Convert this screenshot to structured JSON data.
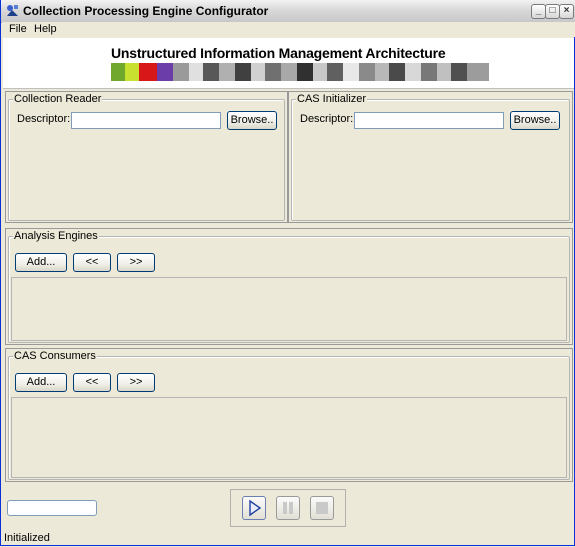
{
  "window": {
    "title": "Collection Processing Engine Configurator"
  },
  "menu": {
    "items": [
      "File",
      "Help"
    ]
  },
  "banner": {
    "title": "Unstructured Information Management Architecture"
  },
  "collection_reader": {
    "title": "Collection Reader",
    "descriptor_label": "Descriptor:",
    "descriptor_value": "",
    "browse_label": "Browse.."
  },
  "cas_initializer": {
    "title": "CAS Initializer",
    "descriptor_label": "Descriptor:",
    "descriptor_value": "",
    "browse_label": "Browse.."
  },
  "analysis_engines": {
    "title": "Analysis Engines",
    "add_label": "Add...",
    "move_left_label": "<<",
    "move_right_label": ">>"
  },
  "cas_consumers": {
    "title": "CAS Consumers",
    "add_label": "Add...",
    "move_left_label": "<<",
    "move_right_label": ">>"
  },
  "controls": {
    "play_icon": "play-icon",
    "pause_icon": "pause-icon",
    "stop_icon": "stop-icon"
  },
  "status": {
    "text": "Initialized",
    "progress": 0
  },
  "colors": {
    "window_bg": "#ece9d8",
    "border_blue": "#0831d9",
    "button_border": "#003c74",
    "field_border": "#7f9db9"
  }
}
